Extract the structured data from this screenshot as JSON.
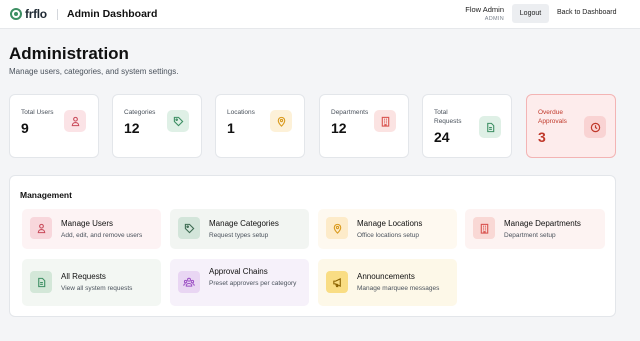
{
  "header": {
    "logo_text": "frflo",
    "app_title": "Admin Dashboard",
    "user_name": "Flow Admin",
    "user_role": "ADMIN",
    "logout_label": "Logout",
    "back_label": "Back to Dashboard"
  },
  "page": {
    "title": "Administration",
    "subtitle": "Manage users, categories, and system settings."
  },
  "stats": [
    {
      "label": "Total Users",
      "value": "9",
      "icon": "users-icon",
      "color": "#c94a5a"
    },
    {
      "label": "Categories",
      "value": "12",
      "icon": "tag-icon",
      "color": "#3d8f63"
    },
    {
      "label": "Locations",
      "value": "1",
      "icon": "location-pin-icon",
      "color": "#d99a1e"
    },
    {
      "label": "Departments",
      "value": "12",
      "icon": "building-icon",
      "color": "#d9534f"
    },
    {
      "label": "Total Requests",
      "value": "24",
      "icon": "document-icon",
      "color": "#3d8f63"
    },
    {
      "label": "Overdue Approvals",
      "value": "3",
      "icon": "clock-icon",
      "color": "#c0392b"
    }
  ],
  "management": {
    "title": "Management",
    "tiles": [
      {
        "name": "Manage Users",
        "desc": "Add, edit, and remove users",
        "icon": "users-icon"
      },
      {
        "name": "Manage Categories",
        "desc": "Request types setup",
        "icon": "tag-icon"
      },
      {
        "name": "Manage Locations",
        "desc": "Office locations setup",
        "icon": "location-pin-icon"
      },
      {
        "name": "Manage Departments",
        "desc": "Department setup",
        "icon": "building-icon"
      },
      {
        "name": "All Requests",
        "desc": "View all system requests",
        "icon": "document-icon"
      },
      {
        "name": "Approval Chains",
        "desc": "Preset approvers per category",
        "icon": "approval-chain-icon"
      },
      {
        "name": "Announcements",
        "desc": "Manage marquee messages",
        "icon": "megaphone-icon"
      }
    ]
  },
  "colors": {
    "brand_green": "#3d8f63",
    "alert_red": "#c0392b"
  }
}
